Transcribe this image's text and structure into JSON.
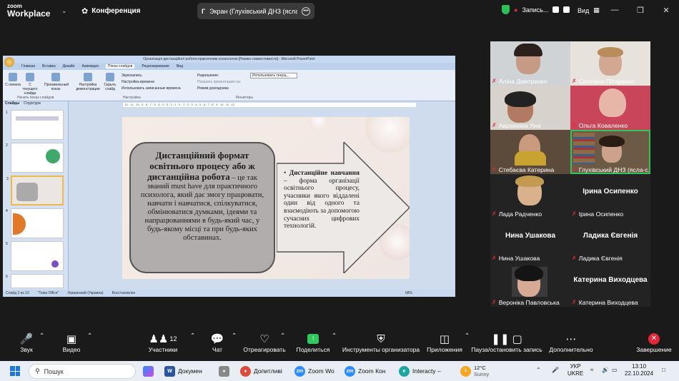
{
  "topbar": {
    "logo_line1": "zoom",
    "logo_line2": "Workplace",
    "conference_label": "Конференция",
    "screen_share_letter": "Г",
    "screen_share_title": "Экран (Глухівський ДНЗ (ясла-с",
    "recording_label": "Запись...",
    "view_label": "Вид"
  },
  "powerpoint": {
    "window_title": "Організація дистанційної роботи практичним психологом [Режим совместимости] - Microsoft PowerPoint",
    "tabs": [
      "Главная",
      "Вставка",
      "Дизайн",
      "Анимация",
      "Показ слайдов",
      "Рецензирование",
      "Вид"
    ],
    "ribbon": {
      "btn_start": "С начала",
      "btn_current": "С текущего слайда",
      "btn_custom": "Произвольный показ",
      "btn_setup": "Настройка демонстрации",
      "btn_hide": "Скрыть слайд",
      "opt_sound": "Звукозапись",
      "opt_timing": "Настройка времени",
      "opt_use_timing": "Использовать записанные времена",
      "opt_resolution": "Разрешение:",
      "opt_resolution_value": "Использовать текущ...",
      "opt_show_on": "Показать презентацию на:",
      "opt_presenter": "Режим докладчика",
      "group_start": "Начать показ слайдов",
      "group_setup": "Настройка",
      "group_monitors": "Мониторы"
    },
    "left_tabs": [
      "Слайды",
      "Структура"
    ],
    "slide": {
      "left_heading": "Дистанційний формат освітнього процесу або ж дистанційна робота",
      "left_body": " – це так званий must have для практичного психолога, який дає змогу працювати, навчати і навчатися, спілкуватися, обмінюватися думками, ідеями та напрацюваннями в будь-який час, у будь-якому місці та при будь-яких обставинах.",
      "right_heading": "Дистанційне навчання",
      "right_body": " – форма організації освітнього процесу, учасники якого віддалені один від одного та взаємодіють за допомогою сучасних цифрових технологій."
    },
    "status": {
      "slide_num": "Слайд 3 из 10",
      "theme": "\"Тема Office\"",
      "lang": "Украинский (Украина)",
      "restore": "Восстановлен",
      "zoom": "68%"
    }
  },
  "participants": [
    {
      "name": "Аліна Дмитренко",
      "muted": true
    },
    {
      "name": "Світлана Пітаренко",
      "muted": true
    },
    {
      "name": "Аврамкіна Яна",
      "muted": true
    },
    {
      "name": "Ольга Коваленко",
      "muted": true
    },
    {
      "name": "Стебаєва Катерина",
      "muted": true
    },
    {
      "name": "Глухівський ДНЗ (ясла-с...",
      "muted": true
    },
    {
      "name": "Лада Радченко",
      "muted": true
    },
    {
      "name": "Ірина Осипенко",
      "muted": true,
      "big": "Ірина Осипенко"
    },
    {
      "name": "Нина Ушакова",
      "muted": true,
      "big": "Нина Ушакова"
    },
    {
      "name": "Ладика Євгенія",
      "muted": true,
      "big": "Ладика Євгенія"
    },
    {
      "name": "Вероніка Павловська",
      "muted": true
    },
    {
      "name": "Катерина Виходцева",
      "muted": true,
      "big": "Катерина  Виходцева"
    }
  ],
  "toolbar": {
    "audio": "Звук",
    "video": "Видео",
    "participants": "Участники",
    "participants_count": "12",
    "chat": "Чат",
    "react": "Отреагировать",
    "share": "Поделиться",
    "host_tools": "Инструменты организатора",
    "apps": "Приложения",
    "pause_record": "Пауза/остановить запись",
    "more": "Дополнительно",
    "end": "Завершение"
  },
  "taskbar": {
    "search_placeholder": "Пошук",
    "apps": [
      {
        "label": "Докумен",
        "icon": "word"
      },
      {
        "label": "Допитливі",
        "icon": "chrome"
      },
      {
        "label": "Zoom Wo",
        "icon": "zoom"
      },
      {
        "label": "Zoom Кон",
        "icon": "zoom"
      },
      {
        "label": "Interacty –",
        "icon": "edge"
      }
    ],
    "weather_temp": "12°C",
    "weather_desc": "Sunny",
    "lang_top": "УКР",
    "lang_bottom": "UKRE",
    "time": "13:10",
    "date": "22.10.2024"
  },
  "colors": {
    "zoom_bg": "#1a1a1a",
    "share_green": "#31c75e",
    "end_red": "#e3273b",
    "active_speaker": "#30c55a"
  }
}
